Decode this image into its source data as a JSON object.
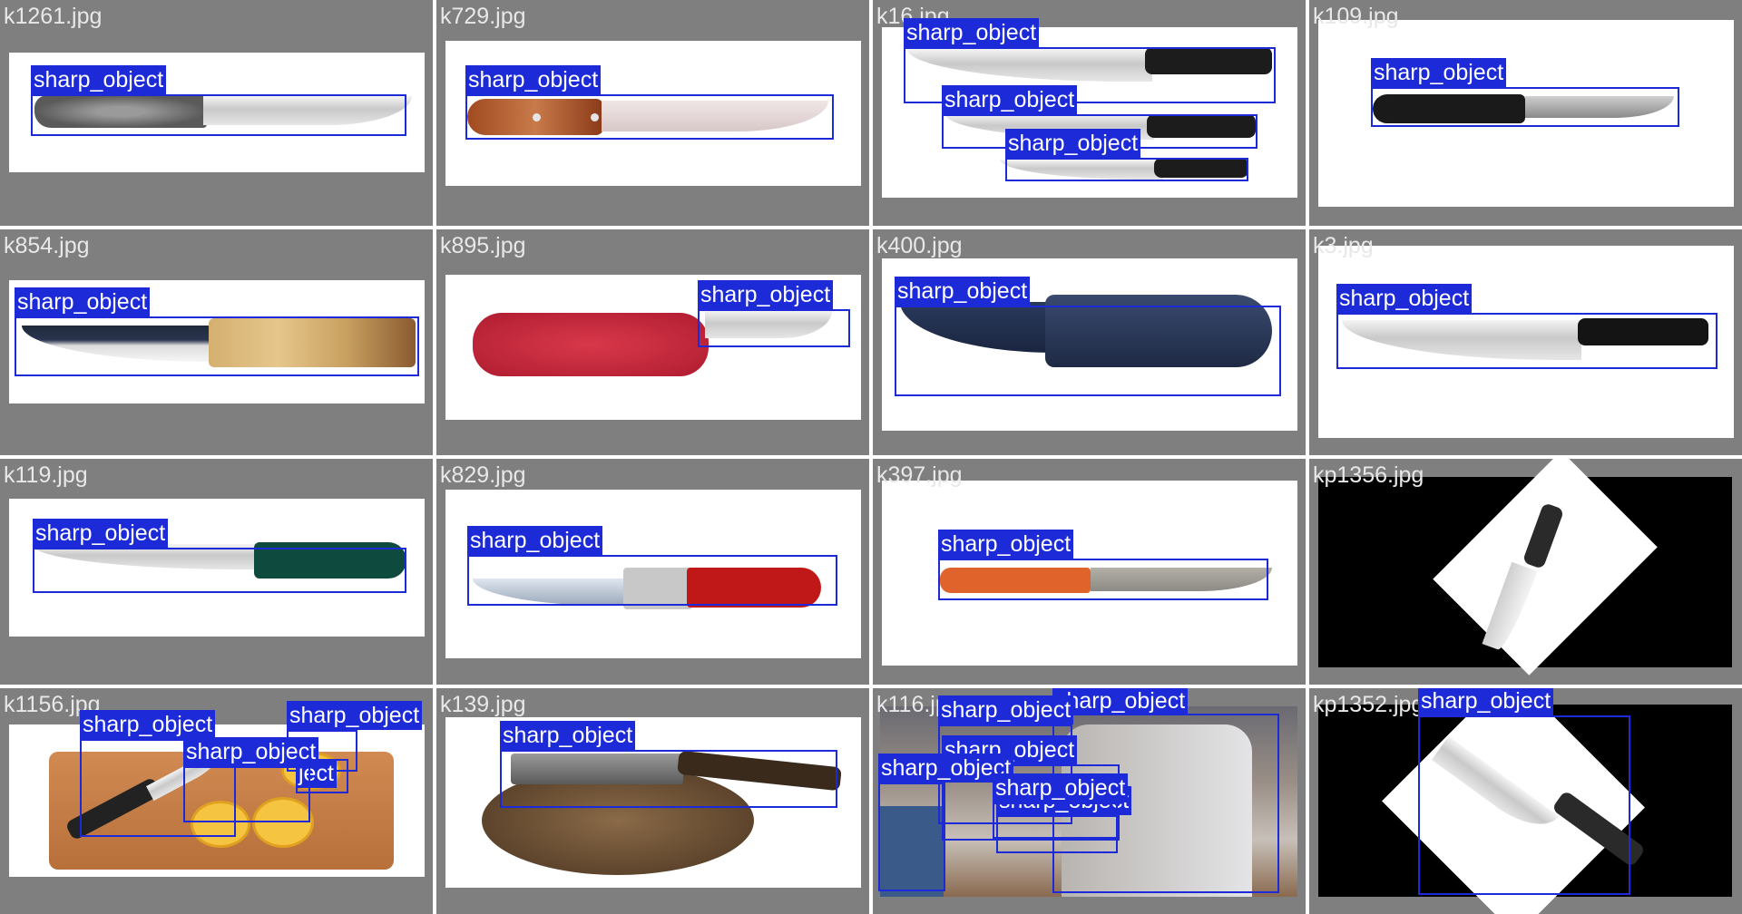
{
  "label_color": "#1c2ad8",
  "tiles": [
    {
      "filename": "k1261.jpg",
      "boxes": [
        "sharp_object"
      ]
    },
    {
      "filename": "k729.jpg",
      "boxes": [
        "sharp_object"
      ]
    },
    {
      "filename": "k16.jpg",
      "boxes": [
        "sharp_object",
        "sharp_object",
        "sharp_object"
      ]
    },
    {
      "filename": "k109.jpg",
      "boxes": [
        "sharp_object"
      ]
    },
    {
      "filename": "k854.jpg",
      "boxes": [
        "sharp_object"
      ]
    },
    {
      "filename": "k895.jpg",
      "boxes": [
        "sharp_object"
      ]
    },
    {
      "filename": "k400.jpg",
      "boxes": [
        "sharp_object"
      ]
    },
    {
      "filename": "k3.jpg",
      "boxes": [
        "sharp_object"
      ]
    },
    {
      "filename": "k119.jpg",
      "boxes": [
        "sharp_object"
      ]
    },
    {
      "filename": "k829.jpg",
      "boxes": [
        "sharp_object"
      ]
    },
    {
      "filename": "k397.jpg",
      "boxes": [
        "sharp_object"
      ]
    },
    {
      "filename": "kp1356.jpg",
      "boxes": []
    },
    {
      "filename": "k1156.jpg",
      "boxes": [
        "sharp_object",
        "sharp_object",
        "sharp_object",
        "sharp_object"
      ]
    },
    {
      "filename": "k139.jpg",
      "boxes": [
        "sharp_object"
      ]
    },
    {
      "filename": "k116.jpg",
      "boxes": [
        "sharp_object",
        "sharp_object",
        "sharp_object",
        "sharp_object",
        "sharp_object",
        "sharp_object"
      ]
    },
    {
      "filename": "kp1352.jpg",
      "boxes": [
        "sharp_object"
      ]
    }
  ]
}
